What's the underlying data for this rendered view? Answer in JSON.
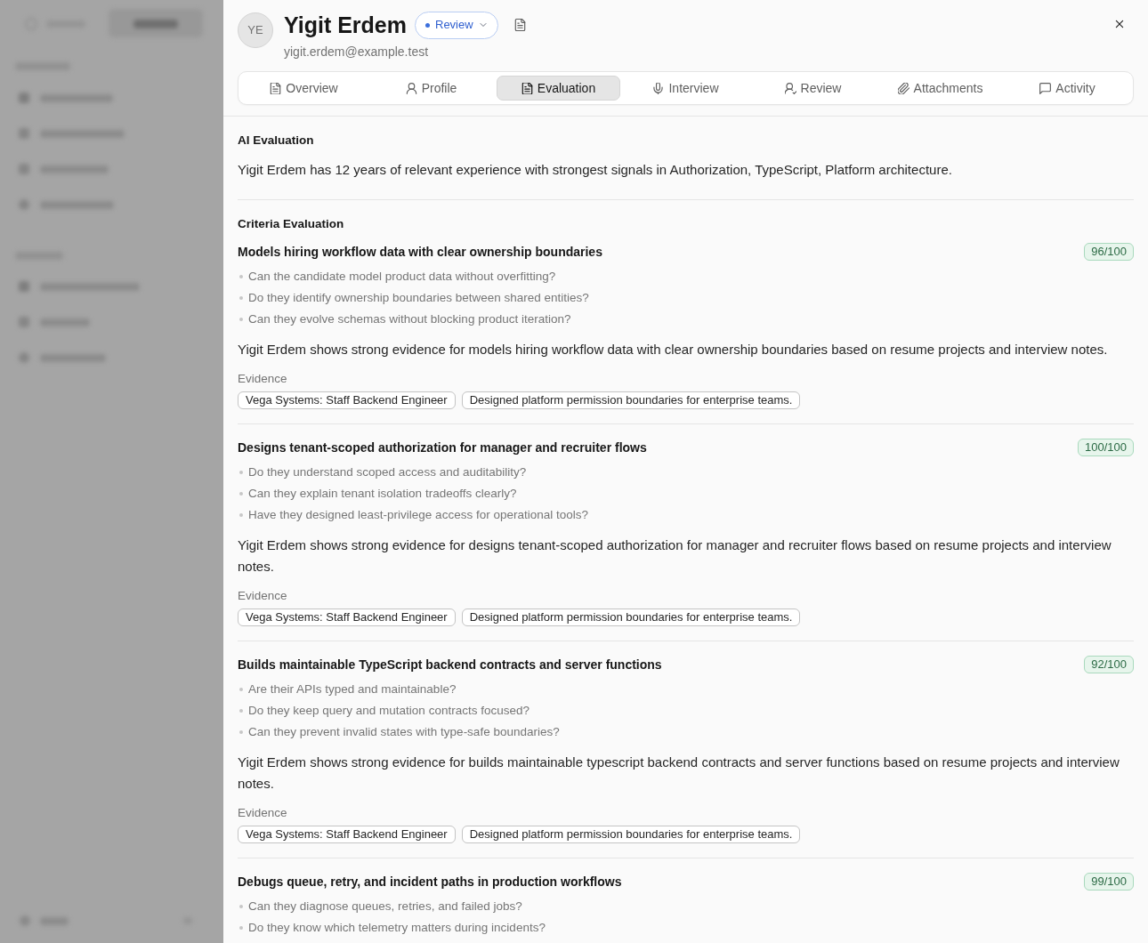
{
  "candidate": {
    "initials": "YE",
    "name": "Yigit Erdem",
    "status": "Review",
    "email": "yigit.erdem@example.test"
  },
  "tabs": [
    {
      "label": "Overview",
      "selected": false
    },
    {
      "label": "Profile",
      "selected": false
    },
    {
      "label": "Evaluation",
      "selected": true
    },
    {
      "label": "Interview",
      "selected": false
    },
    {
      "label": "Review",
      "selected": false
    },
    {
      "label": "Attachments",
      "selected": false
    },
    {
      "label": "Activity",
      "selected": false
    }
  ],
  "ai_evaluation": {
    "heading": "AI Evaluation",
    "summary": "Yigit Erdem has 12 years of relevant experience with strongest signals in Authorization, TypeScript, Platform architecture."
  },
  "criteria_evaluation": {
    "heading": "Criteria Evaluation",
    "criteria": [
      {
        "title": "Models hiring workflow data with clear ownership boundaries",
        "score": "96/100",
        "questions": [
          "Can the candidate model product data without overfitting?",
          "Do they identify ownership boundaries between shared entities?",
          "Can they evolve schemas without blocking product iteration?"
        ],
        "summary": "Yigit Erdem shows strong evidence for models hiring workflow data with clear ownership boundaries based on resume projects and interview notes.",
        "evidence_label": "Evidence",
        "evidence": [
          "Vega Systems: Staff Backend Engineer",
          "Designed platform permission boundaries for enterprise teams."
        ]
      },
      {
        "title": "Designs tenant-scoped authorization for manager and recruiter flows",
        "score": "100/100",
        "questions": [
          "Do they understand scoped access and auditability?",
          "Can they explain tenant isolation tradeoffs clearly?",
          "Have they designed least-privilege access for operational tools?"
        ],
        "summary": "Yigit Erdem shows strong evidence for designs tenant-scoped authorization for manager and recruiter flows based on resume projects and interview notes.",
        "evidence_label": "Evidence",
        "evidence": [
          "Vega Systems: Staff Backend Engineer",
          "Designed platform permission boundaries for enterprise teams."
        ]
      },
      {
        "title": "Builds maintainable TypeScript backend contracts and server functions",
        "score": "92/100",
        "questions": [
          "Are their APIs typed and maintainable?",
          "Do they keep query and mutation contracts focused?",
          "Can they prevent invalid states with type-safe boundaries?"
        ],
        "summary": "Yigit Erdem shows strong evidence for builds maintainable typescript backend contracts and server functions based on resume projects and interview notes.",
        "evidence_label": "Evidence",
        "evidence": [
          "Vega Systems: Staff Backend Engineer",
          "Designed platform permission boundaries for enterprise teams."
        ]
      },
      {
        "title": "Debugs queue, retry, and incident paths in production workflows",
        "score": "99/100",
        "questions": [
          "Can they diagnose queues, retries, and failed jobs?",
          "Do they know which telemetry matters during incidents?"
        ]
      }
    ]
  }
}
